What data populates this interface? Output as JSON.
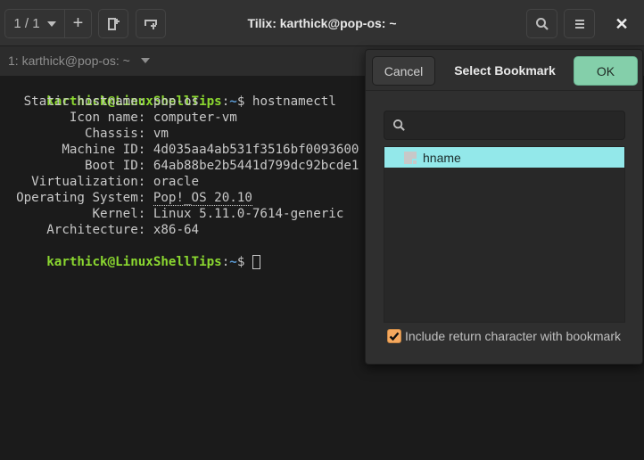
{
  "window": {
    "title": "Tilix: karthick@pop-os: ~",
    "session_counter": "1 / 1",
    "close_glyph": "✕"
  },
  "tabbar": {
    "active_terminal_title": "1: karthick@pop-os: ~"
  },
  "toolbar_icons": {
    "session_switcher": "caret-down-icon",
    "add_session": "plus-icon",
    "split_horizontal": "split-right-icon",
    "split_vertical": "split-down-icon",
    "find": "search-icon",
    "menu": "hamburger-menu-icon",
    "close": "close-icon"
  },
  "terminal": {
    "prompt_user_host": "karthick@LinuxShellTips",
    "prompt_colon": ":",
    "prompt_path": "~",
    "prompt_symbol": "$ ",
    "command": "hostnamectl",
    "output": [
      {
        "key": "   Static hostname: ",
        "value": "pop-os"
      },
      {
        "key": "         Icon name: ",
        "value": "computer-vm"
      },
      {
        "key": "           Chassis: ",
        "value": "vm"
      },
      {
        "key": "        Machine ID: ",
        "value": "4d035aa4ab531f3516bf0093600"
      },
      {
        "key": "           Boot ID: ",
        "value": "64ab88be2b5441d799dc92bcde1"
      },
      {
        "key": "    Virtualization: ",
        "value": "oracle"
      },
      {
        "key": "  Operating System: ",
        "value": "Pop!_OS 20.10"
      },
      {
        "key": "            Kernel: ",
        "value": "Linux 5.11.0-7614-generic"
      },
      {
        "key": "      Architecture: ",
        "value": "x86-64"
      }
    ]
  },
  "bookmark_dialog": {
    "title": "Select Bookmark",
    "cancel_label": "Cancel",
    "ok_label": "OK",
    "search_value": "",
    "search_placeholder": "",
    "items": [
      {
        "label": "hname",
        "selected": true,
        "icon": "bookmark-icon"
      }
    ],
    "include_return_label": "Include return character with bookmark",
    "include_return_checked": true
  },
  "colors": {
    "prompt_user": "#8bd830",
    "prompt_path": "#5b9bd5",
    "ok_button": "#84cfaa",
    "selected_row": "#93e8ea",
    "checkbox": "#f5a85e"
  }
}
